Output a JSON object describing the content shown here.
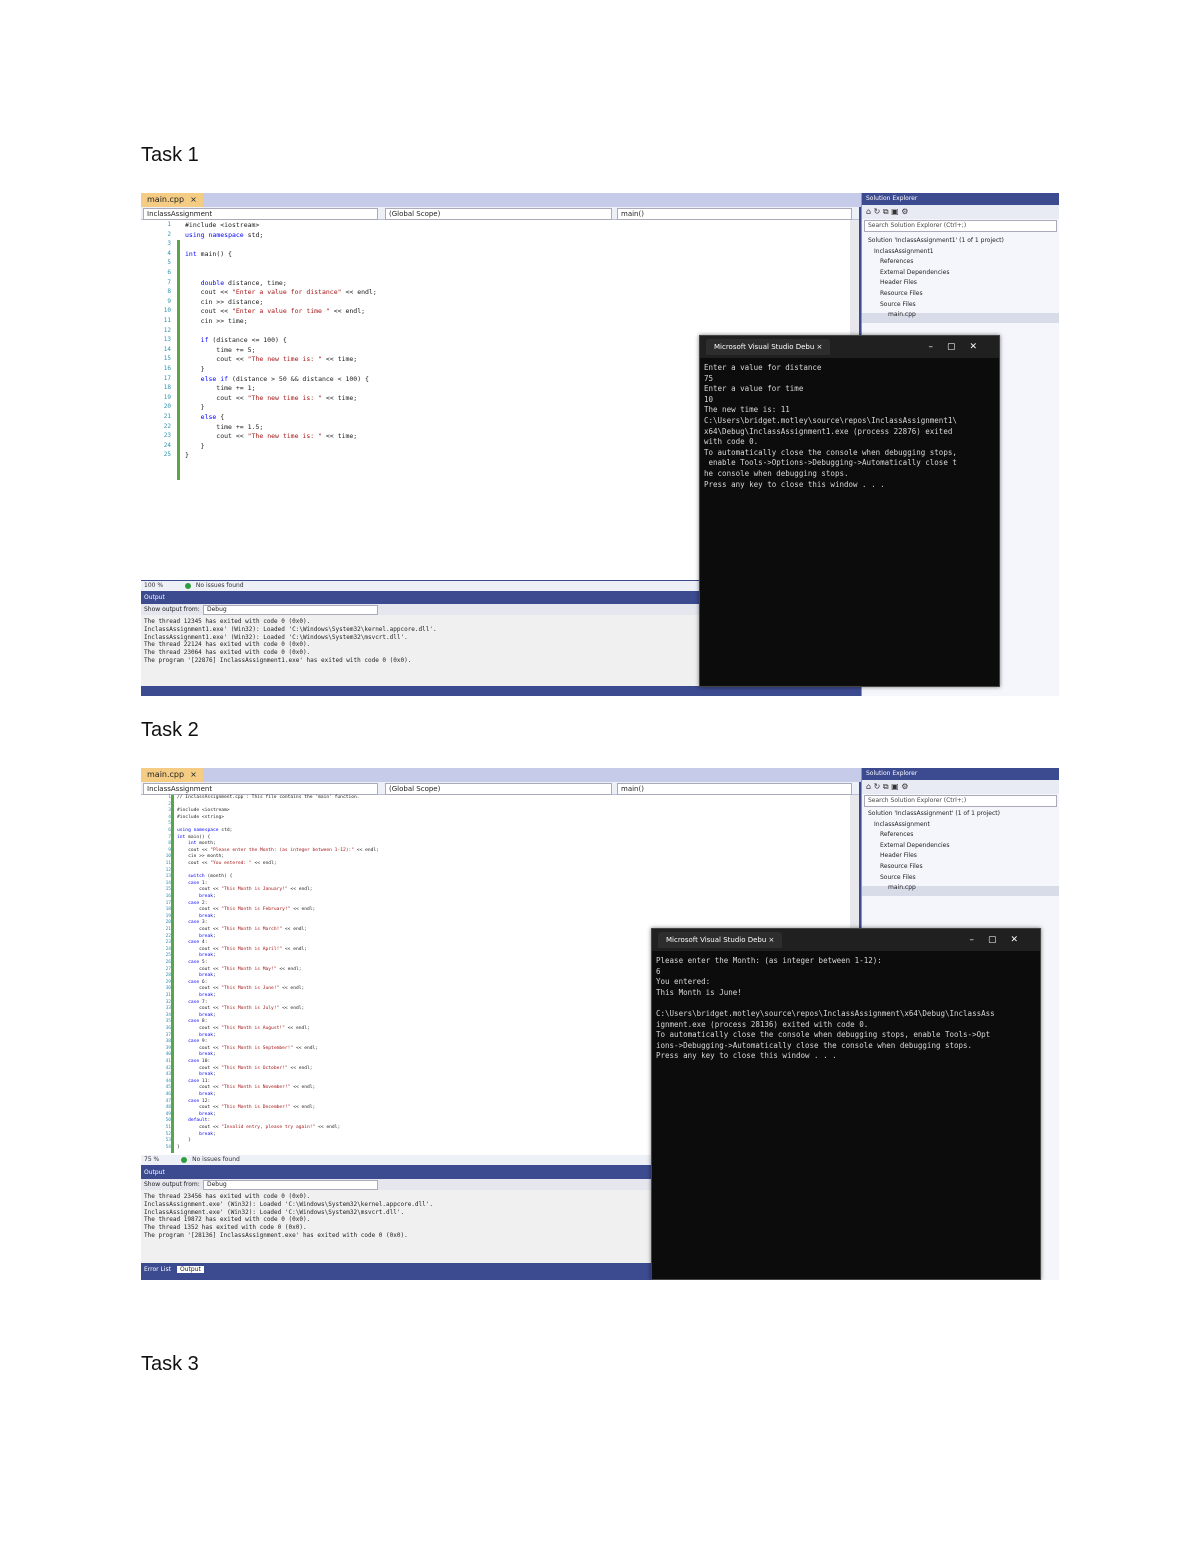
{
  "tasks": [
    {
      "heading": "Task 1"
    },
    {
      "heading": "Task 2"
    },
    {
      "heading": "Task 3"
    }
  ],
  "shot1": {
    "file_tab": "main.cpp",
    "project_dropdown": "InclassAssignment",
    "scope_dropdown": "(Global Scope)",
    "function_dropdown": "main()",
    "zoom": "100 %",
    "issues": "No issues found",
    "output_title": "Output",
    "show_output_from_label": "Show output from:",
    "show_output_from_value": "Debug",
    "output_lines": [
      "The thread 12345 has exited with code 0 (0x0).",
      "InclassAssignment1.exe' (Win32): Loaded 'C:\\Windows\\System32\\kernel.appcore.dll'.",
      "InclassAssignment1.exe' (Win32): Loaded 'C:\\Windows\\System32\\msvcrt.dll'.",
      "The thread 22124 has exited with code 0 (0x0).",
      "The thread 23064 has exited with code 0 (0x0).",
      "The program '[22876] InclassAssignment1.exe' has exited with code 0 (0x0)."
    ],
    "code_lines": [
      "#include <iostream>",
      "using namespace std;",
      "",
      "int main() {",
      "",
      "",
      "    double distance, time;",
      "    cout << \"Enter a value for distance\" << endl;",
      "    cin >> distance;",
      "    cout << \"Enter a value for time \" << endl;",
      "    cin >> time;",
      "",
      "    if (distance <= 100) {",
      "        time += 5;",
      "        cout << \"The new time is: \" << time;",
      "    }",
      "    else if (distance > 50 && distance < 100) {",
      "        time += 1;",
      "        cout << \"The new time is: \" << time;",
      "    }",
      "    else {",
      "        time += 1.5;",
      "        cout << \"The new time is: \" << time;",
      "    }",
      "}"
    ],
    "solution_explorer": {
      "title": "Solution Explorer",
      "search": "Search Solution Explorer (Ctrl+;)",
      "items": [
        "Solution 'InclassAssignment1' (1 of 1 project)",
        "InclassAssignment1",
        "References",
        "External Dependencies",
        "Header Files",
        "Resource Files",
        "Source Files",
        "main.cpp"
      ]
    },
    "console": {
      "title": "Microsoft Visual Studio Debu",
      "lines": [
        "Enter a value for distance",
        "75",
        "Enter a value for time",
        "10",
        "The new time is: 11",
        "C:\\Users\\bridget.motley\\source\\repos\\InclassAssignment1\\",
        "x64\\Debug\\InclassAssignment1.exe (process 22876) exited",
        "with code 0.",
        "To automatically close the console when debugging stops,",
        " enable Tools->Options->Debugging->Automatically close t",
        "he console when debugging stops.",
        "Press any key to close this window . . ."
      ]
    }
  },
  "shot2": {
    "file_tab": "main.cpp",
    "project_dropdown": "InclassAssignment",
    "scope_dropdown": "(Global Scope)",
    "function_dropdown": "main()",
    "zoom": "75 %",
    "issues": "No issues found",
    "output_title": "Output",
    "show_output_from_label": "Show output from:",
    "show_output_from_value": "Debug",
    "output_lines": [
      "The thread 23456 has exited with code 0 (0x0).",
      "InclassAssignment.exe' (Win32): Loaded 'C:\\Windows\\System32\\kernel.appcore.dll'.",
      "InclassAssignment.exe' (Win32): Loaded 'C:\\Windows\\System32\\msvcrt.dll'.",
      "The thread 19872 has exited with code 0 (0x0).",
      "The thread 1352 has exited with code 0 (0x0).",
      "The program '[28136] InclassAssignment.exe' has exited with code 0 (0x0)."
    ],
    "bottom_tabs": [
      "Error List",
      "Output"
    ],
    "code_lines": [
      "// InclassAssignment.cpp : This file contains the 'main' function.",
      "",
      "#include <iostream>",
      "#include <string>",
      "",
      "using namespace std;",
      "int main() {",
      "    int month;",
      "    cout << \"Please enter the Month: (as integer between 1-12):\" << endl;",
      "    cin >> month;",
      "    cout << \"You entered: \" << endl;",
      "",
      "    switch (month) {",
      "    case 1:",
      "        cout << \"This Month is January!\" << endl;",
      "        break;",
      "    case 2:",
      "        cout << \"This Month is February!\" << endl;",
      "        break;",
      "    case 3:",
      "        cout << \"This Month is March!\" << endl;",
      "        break;",
      "    case 4:",
      "        cout << \"This Month is April!\" << endl;",
      "        break;",
      "    case 5:",
      "        cout << \"This Month is May!\" << endl;",
      "        break;",
      "    case 6:",
      "        cout << \"This Month is June!\" << endl;",
      "        break;",
      "    case 7:",
      "        cout << \"This Month is July!\" << endl;",
      "        break;",
      "    case 8:",
      "        cout << \"This Month is August!\" << endl;",
      "        break;",
      "    case 9:",
      "        cout << \"This Month is September!\" << endl;",
      "        break;",
      "    case 10:",
      "        cout << \"This Month is October!\" << endl;",
      "        break;",
      "    case 11:",
      "        cout << \"This Month is November!\" << endl;",
      "        break;",
      "    case 12:",
      "        cout << \"This Month is December!\" << endl;",
      "        break;",
      "    default:",
      "        cout << \"Invalid entry, please try again!\" << endl;",
      "        break;",
      "    }",
      "}"
    ],
    "solution_explorer": {
      "title": "Solution Explorer",
      "search": "Search Solution Explorer (Ctrl+;)",
      "items": [
        "Solution 'InclassAssignment' (1 of 1 project)",
        "InclassAssignment",
        "References",
        "External Dependencies",
        "Header Files",
        "Resource Files",
        "Source Files",
        "main.cpp"
      ]
    },
    "console": {
      "title": "Microsoft Visual Studio Debu",
      "lines": [
        "Please enter the Month: (as integer between 1-12):",
        "6",
        "You entered:",
        "This Month is June!",
        "",
        "C:\\Users\\bridget.motley\\source\\repos\\InclassAssignment\\x64\\Debug\\InclassAss",
        "ignment.exe (process 28136) exited with code 0.",
        "To automatically close the console when debugging stops, enable Tools->Opt",
        "ions->Debugging->Automatically close the console when debugging stops.",
        "Press any key to close this window . . ."
      ]
    }
  }
}
